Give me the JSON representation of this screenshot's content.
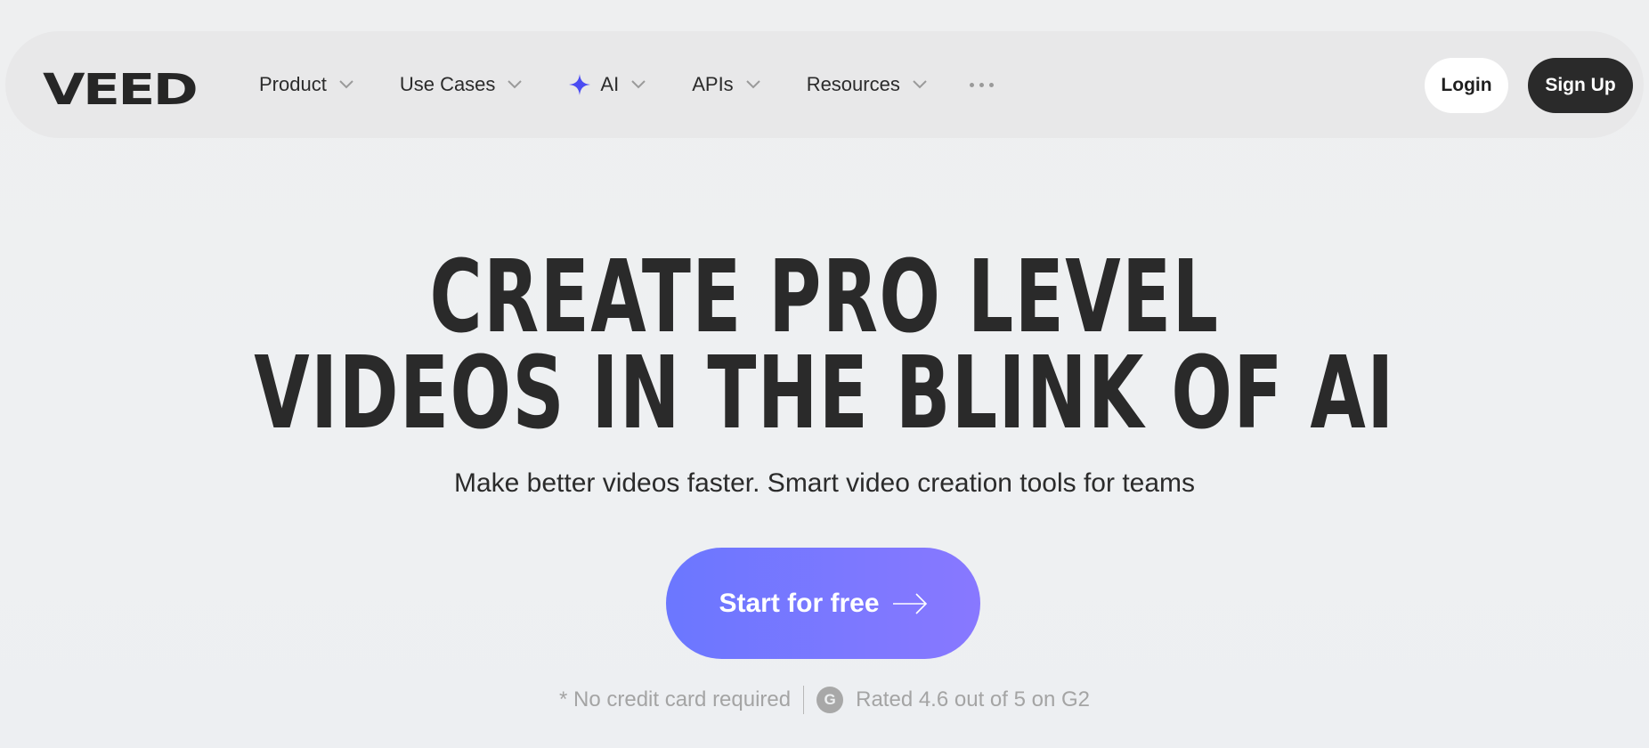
{
  "brand": {
    "logo_text": "VEED"
  },
  "nav": {
    "items": [
      {
        "label": "Product",
        "icon": "chevron-down-icon"
      },
      {
        "label": "Use Cases",
        "icon": "chevron-down-icon"
      },
      {
        "label": "AI",
        "icon": "chevron-down-icon",
        "leading_icon": "sparkle-icon",
        "leading_icon_color": "#4b4cf2"
      },
      {
        "label": "APIs",
        "icon": "chevron-down-icon"
      },
      {
        "label": "Resources",
        "icon": "chevron-down-icon"
      }
    ],
    "more_icon": "more-dots-icon",
    "login_label": "Login",
    "signup_label": "Sign Up"
  },
  "hero": {
    "title_line1": "CREATE PRO LEVEL",
    "title_line2": "VIDEOS IN THE BLINK OF AI",
    "subtitle": "Make better videos faster. Smart video creation tools for teams",
    "cta_label": "Start for free",
    "cta_icon": "arrow-right-icon",
    "cta_gradient": [
      "#6b77ff",
      "#8878ff"
    ],
    "note_left": "* No credit card required",
    "g2_badge": "G",
    "note_right": "Rated 4.6 out of 5 on G2"
  },
  "colors": {
    "background": "#eff0f1",
    "navbar": "#e8e8e9",
    "text": "#2b2b2b",
    "signup_bg": "#2a2a2a"
  }
}
